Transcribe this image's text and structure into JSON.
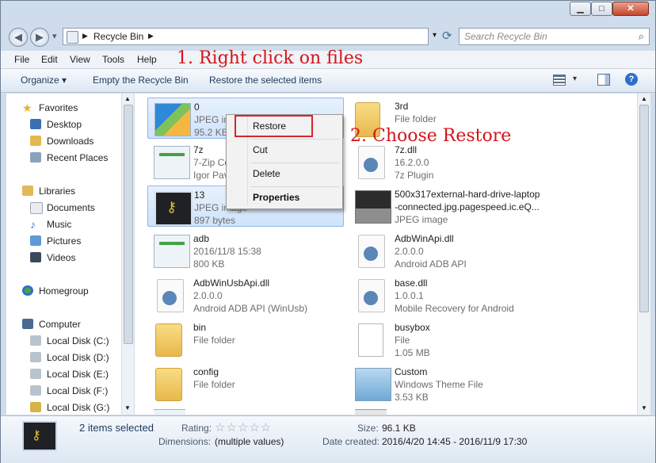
{
  "window": {
    "controls": {
      "minimize": "▁",
      "maximize": "□",
      "close": "✕"
    }
  },
  "nav": {
    "back_icon": "◀",
    "forward_icon": "▶",
    "dropdown_icon": "▾",
    "breadcrumb": [
      "Recycle Bin"
    ],
    "refresh_icon": "⟳",
    "search_placeholder": "Search Recycle Bin"
  },
  "menu": [
    "File",
    "Edit",
    "View",
    "Tools",
    "Help"
  ],
  "toolbar": {
    "organize": "Organize",
    "empty": "Empty the Recycle Bin",
    "restore_all": "Restore the selected items",
    "help_icon": "?"
  },
  "navpane": {
    "favorites": {
      "label": "Favorites",
      "items": [
        "Desktop",
        "Downloads",
        "Recent Places"
      ]
    },
    "libraries": {
      "label": "Libraries",
      "items": [
        "Documents",
        "Music",
        "Pictures",
        "Videos"
      ]
    },
    "homegroup": "Homegroup",
    "computer": {
      "label": "Computer",
      "items": [
        "Local Disk (C:)",
        "Local Disk (D:)",
        "Local Disk (E:)",
        "Local Disk (F:)",
        "Local Disk (G:)"
      ]
    }
  },
  "files": [
    {
      "name": "0",
      "line2": "JPEG image",
      "line3": "95.2 KB",
      "icon": "image-icon",
      "selected": true
    },
    {
      "name": "3rd",
      "line2": "File folder",
      "line3": "",
      "icon": "folder-icon",
      "selected": false
    },
    {
      "name": "7z",
      "line2": "7-Zip Console",
      "line3": "Igor Pavlov",
      "icon": "app-window-icon",
      "selected": false
    },
    {
      "name": "7z.dll",
      "line2": "16.2.0.0",
      "line3": "7z Plugin",
      "icon": "dll-gear-icon",
      "selected": false
    },
    {
      "name": "13",
      "line2": "JPEG image",
      "line3": "897 bytes",
      "icon": "key-image-icon",
      "selected": true
    },
    {
      "name": "500x317external-hard-drive-laptop",
      "line2": "-connected.jpg.pagespeed.ic.eQ...",
      "line3": "JPEG image",
      "icon": "laptop-image-icon",
      "selected": false
    },
    {
      "name": "adb",
      "line2": "2016/11/8 15:38",
      "line3": "800 KB",
      "icon": "app-window-icon",
      "selected": false
    },
    {
      "name": "AdbWinApi.dll",
      "line2": "2.0.0.0",
      "line3": "Android ADB API",
      "icon": "dll-gear-icon",
      "selected": false
    },
    {
      "name": "AdbWinUsbApi.dll",
      "line2": "2.0.0.0",
      "line3": "Android ADB API (WinUsb)",
      "icon": "dll-gear-icon",
      "selected": false
    },
    {
      "name": "base.dll",
      "line2": "1.0.0.1",
      "line3": "Mobile Recovery for Android",
      "icon": "dll-gear-icon",
      "selected": false
    },
    {
      "name": "bin",
      "line2": "File folder",
      "line3": "",
      "icon": "folder-icon",
      "selected": false
    },
    {
      "name": "busybox",
      "line2": "File",
      "line3": "1.05 MB",
      "icon": "blank-file-icon",
      "selected": false
    },
    {
      "name": "config",
      "line2": "File folder",
      "line3": "",
      "icon": "folder-icon",
      "selected": false
    },
    {
      "name": "Custom",
      "line2": "Windows Theme File",
      "line3": "3.53 KB",
      "icon": "theme-icon",
      "selected": false
    }
  ],
  "context_menu": [
    "Restore",
    "Cut",
    "Delete",
    "Properties"
  ],
  "annotations": {
    "step1": "1. Right click on files",
    "step2": "2. Choose Restore"
  },
  "status": {
    "selected": "2 items selected",
    "rating_label": "Rating:",
    "stars": "☆☆☆☆☆",
    "dimensions_label": "Dimensions:",
    "dimensions_value": "(multiple values)",
    "size_label": "Size:",
    "size_value": "96.1 KB",
    "date_label": "Date created:",
    "date_value": "2016/4/20 14:45 - 2016/11/9 17:30"
  },
  "colors": {
    "annotation": "#d4151a",
    "selection": "#cfe3fb",
    "link": "#1e395b"
  }
}
